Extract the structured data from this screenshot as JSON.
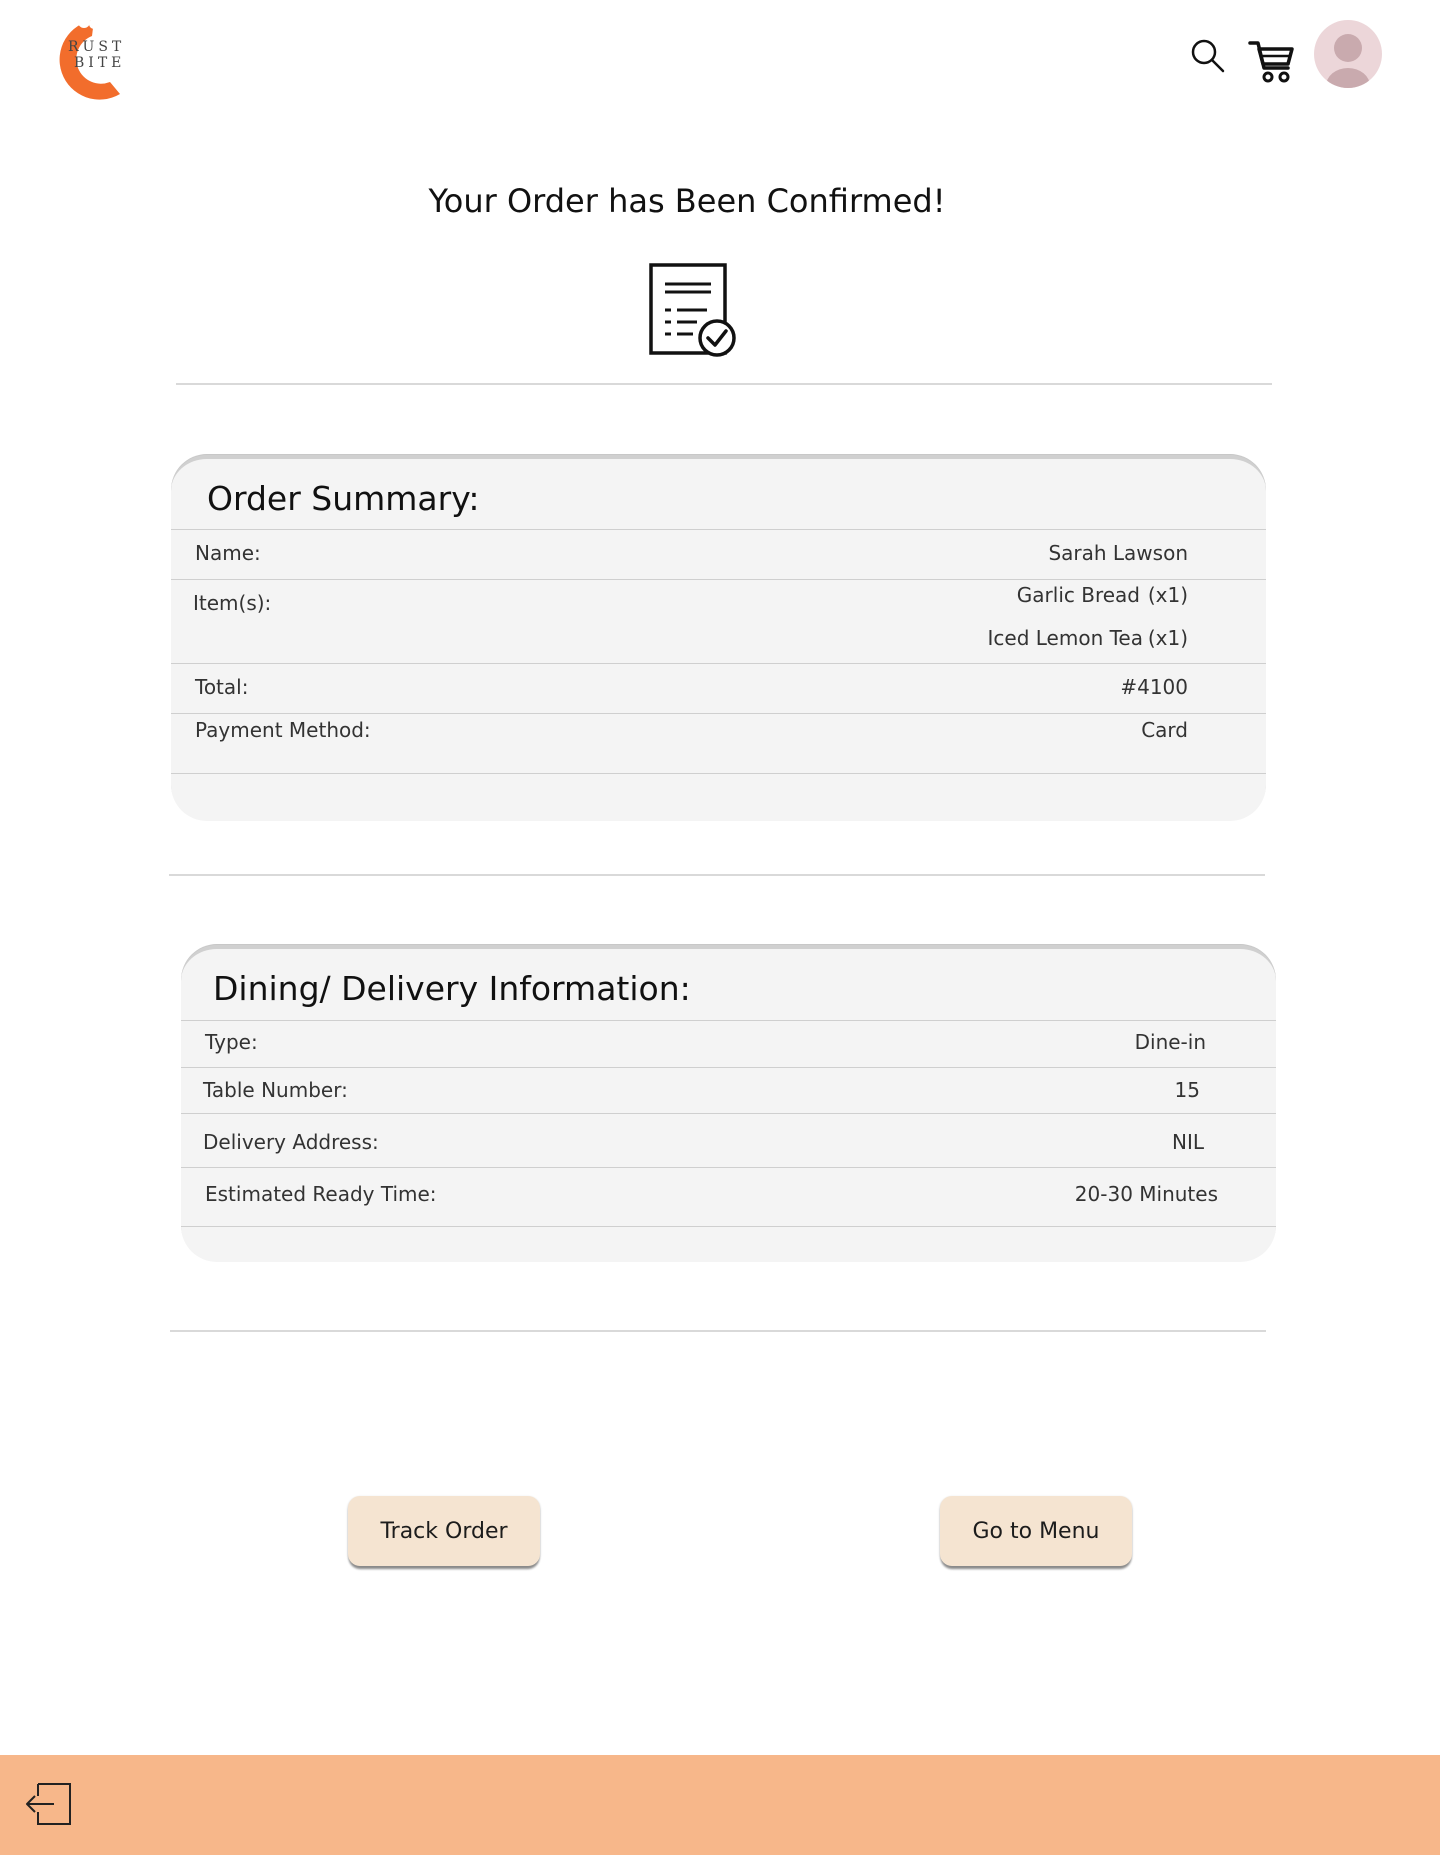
{
  "header": {
    "logo_text_line1": "RUST",
    "logo_text_line2": "BITE",
    "icons": [
      "search-icon",
      "cart-icon",
      "avatar"
    ],
    "brand_color": "#f26d2c"
  },
  "page": {
    "title": "Your Order has Been Confirmed!",
    "confirm_icon": "receipt-check-icon"
  },
  "order_summary": {
    "title": "Order Summary:",
    "name_label": "Name:",
    "name_value": "Sarah Lawson",
    "items_label": "Item(s):",
    "items": [
      {
        "name": "Garlic Bread",
        "qty": "(x1)"
      },
      {
        "name": "Iced Lemon Tea",
        "qty": "(x1)"
      }
    ],
    "total_label": "Total:",
    "total_value": "#4100",
    "payment_label": "Payment Method:",
    "payment_value": "Card"
  },
  "delivery_info": {
    "title": "Dining/ Delivery Information:",
    "type_label": "Type:",
    "type_value": "Dine-in",
    "table_label": "Table Number:",
    "table_value": "15",
    "address_label": "Delivery Address:",
    "address_value": "NIL",
    "time_label": "Estimated Ready Time:",
    "time_value": "20-30 Minutes"
  },
  "actions": {
    "track_label": "Track Order",
    "menu_label": "Go to Menu"
  },
  "footer": {
    "color": "#f7b78a",
    "icon": "logout-icon"
  }
}
